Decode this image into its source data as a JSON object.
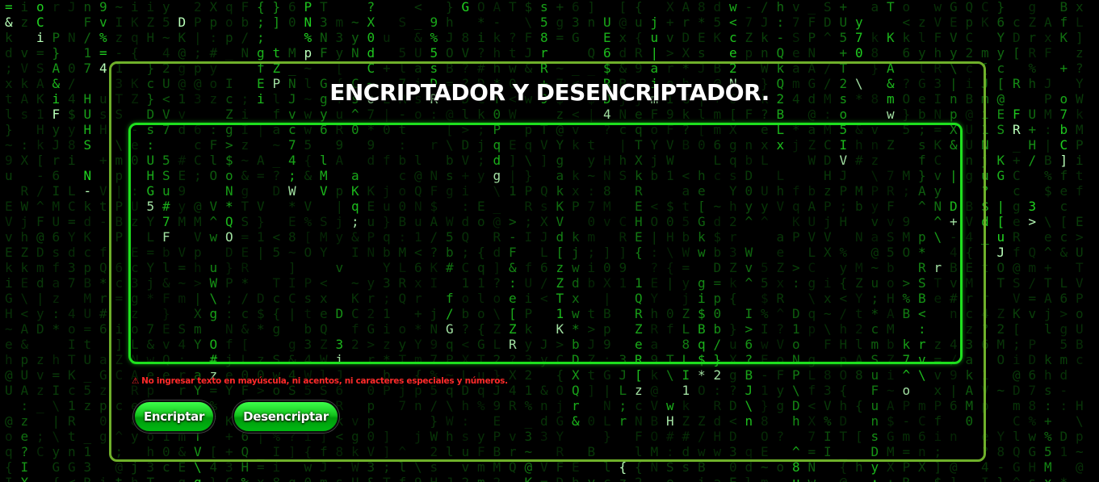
{
  "header": {
    "title": "ENCRIPTADOR Y DESENCRIPTADOR."
  },
  "input": {
    "value": "",
    "placeholder": ""
  },
  "warning": {
    "icon": "warning-triangle-icon",
    "glyph": "⚠",
    "text": "No ingresar texto en mayúscula, ni acentos, ni caracteres especiales y números."
  },
  "buttons": {
    "encrypt_label": "Encriptar",
    "decrypt_label": "Desencriptar"
  },
  "colors": {
    "background": "#000000",
    "matrix_green": "#22e022",
    "panel_border": "#6fb02a",
    "textarea_border": "#1ee01e",
    "button_green": "#14c41e",
    "warning_red": "#ff2a2a",
    "title": "#ffffff"
  }
}
